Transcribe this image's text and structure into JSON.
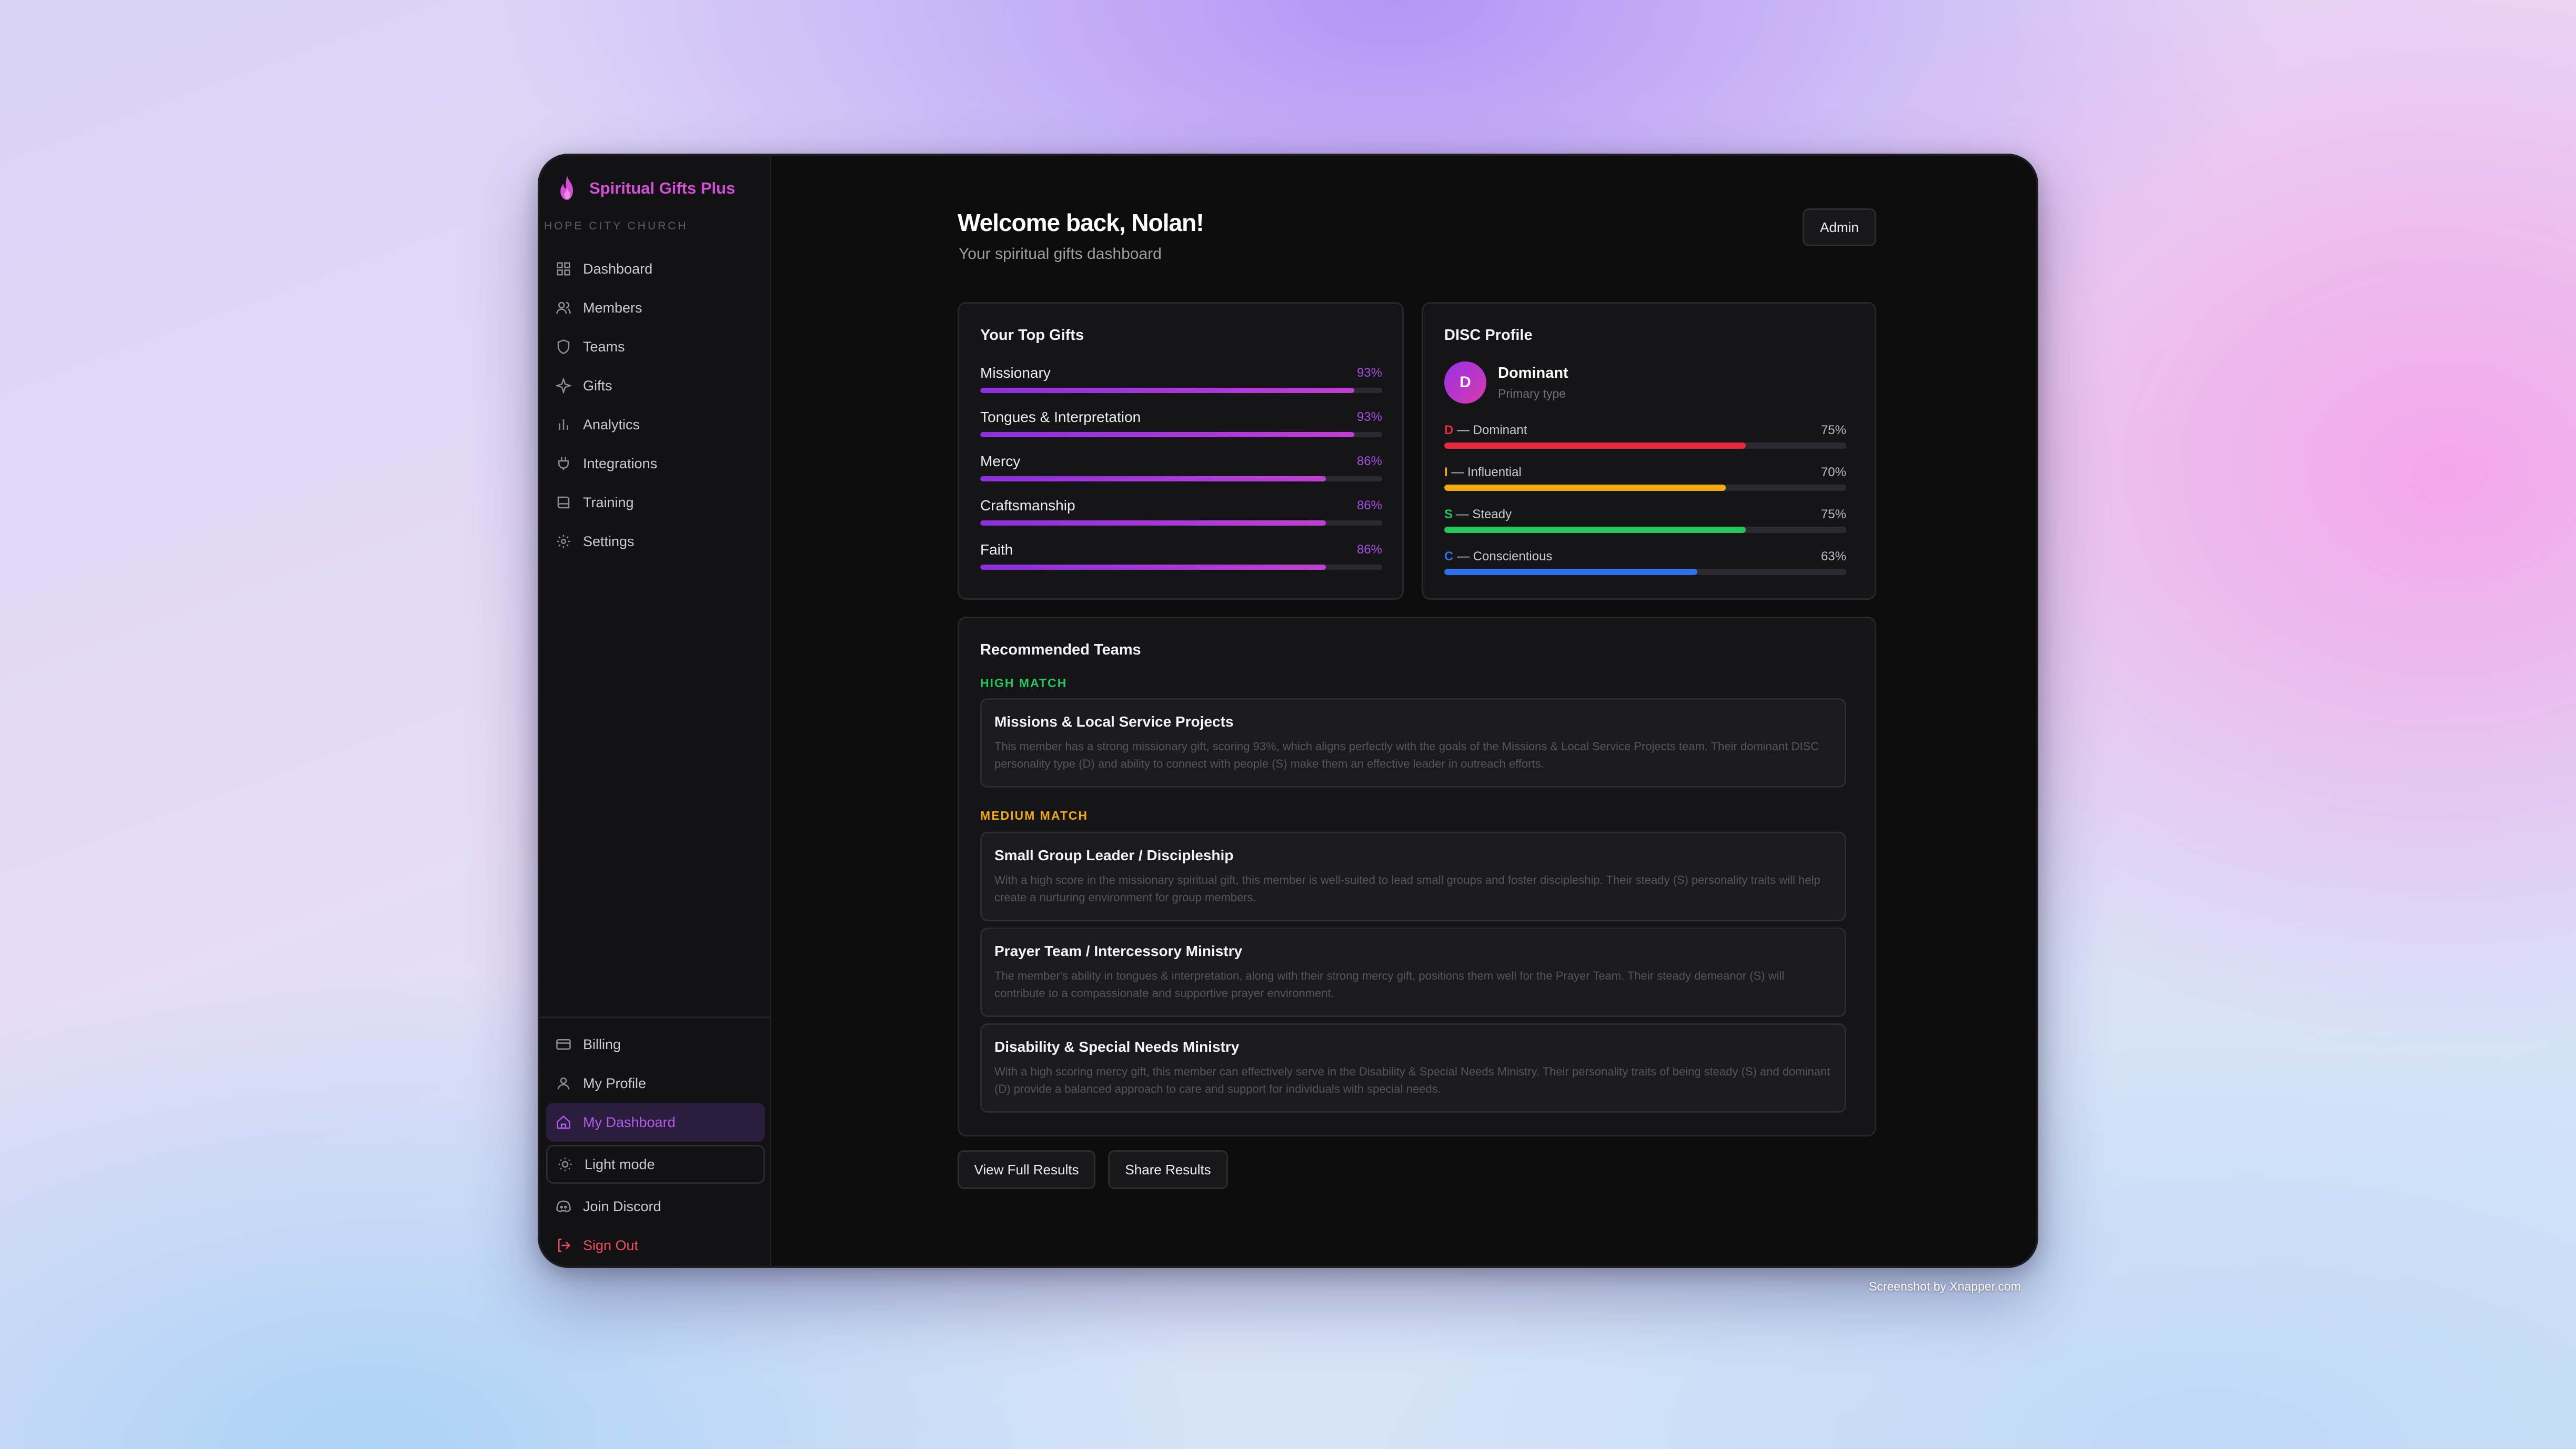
{
  "brand": {
    "name": "Spiritual Gifts Plus",
    "church": "HOPE CITY CHURCH",
    "accent": "#d24fd6"
  },
  "nav": [
    {
      "label": "Dashboard",
      "icon": "grid-icon"
    },
    {
      "label": "Members",
      "icon": "users-icon"
    },
    {
      "label": "Teams",
      "icon": "shield-icon"
    },
    {
      "label": "Gifts",
      "icon": "sparkle-icon"
    },
    {
      "label": "Analytics",
      "icon": "bar-chart-icon"
    },
    {
      "label": "Integrations",
      "icon": "plug-icon"
    },
    {
      "label": "Training",
      "icon": "book-icon"
    },
    {
      "label": "Settings",
      "icon": "gear-icon"
    }
  ],
  "bottom_nav": {
    "billing": "Billing",
    "profile": "My Profile",
    "my_dashboard": "My Dashboard",
    "light_mode": "Light mode",
    "discord": "Join Discord",
    "sign_out": "Sign Out"
  },
  "header": {
    "title": "Welcome back, Nolan!",
    "subtitle": "Your spiritual gifts dashboard",
    "admin_label": "Admin"
  },
  "top_gifts": {
    "title": "Your Top Gifts",
    "items": [
      {
        "name": "Missionary",
        "pct_label": "93%",
        "value": 0.93
      },
      {
        "name": "Tongues & Interpretation",
        "pct_label": "93%",
        "value": 0.93
      },
      {
        "name": "Mercy",
        "pct_label": "86%",
        "value": 0.86
      },
      {
        "name": "Craftsmanship",
        "pct_label": "86%",
        "value": 0.86
      },
      {
        "name": "Faith",
        "pct_label": "86%",
        "value": 0.86
      }
    ]
  },
  "disc": {
    "title": "DISC Profile",
    "avatar_letter": "D",
    "primary_name": "Dominant",
    "primary_caption": "Primary type",
    "rows": [
      {
        "letter": "D",
        "name": " — Dominant",
        "pct_label": "75%",
        "value": 0.75,
        "color": "#e8293d"
      },
      {
        "letter": "I",
        "name": " — Influential",
        "pct_label": "70%",
        "value": 0.7,
        "color": "#f2a90c"
      },
      {
        "letter": "S",
        "name": " — Steady",
        "pct_label": "75%",
        "value": 0.75,
        "color": "#22c55e"
      },
      {
        "letter": "C",
        "name": " — Conscientious",
        "pct_label": "63%",
        "value": 0.63,
        "color": "#2f6fe8"
      }
    ]
  },
  "teams": {
    "title": "Recommended Teams",
    "high_label": "HIGH MATCH",
    "high_color": "#22c55e",
    "medium_label": "MEDIUM MATCH",
    "medium_color": "#f2a90c",
    "items": [
      {
        "name": "Missions & Local Service Projects",
        "desc": "This member has a strong missionary gift, scoring 93%, which aligns perfectly with the goals of the Missions & Local Service Projects team. Their dominant DISC personality type (D) and ability to connect with people (S) make them an effective leader in outreach efforts."
      },
      {
        "name": "Small Group Leader / Discipleship",
        "desc": "With a high score in the missionary spiritual gift, this member is well-suited to lead small groups and foster discipleship. Their steady (S) personality traits will help create a nurturing environment for group members."
      },
      {
        "name": "Prayer Team / Intercessory Ministry",
        "desc": "The member's ability in tongues & interpretation, along with their strong mercy gift, positions them well for the Prayer Team. Their steady demeanor (S) will contribute to a compassionate and supportive prayer environment."
      },
      {
        "name": "Disability & Special Needs Ministry",
        "desc": "With a high scoring mercy gift, this member can effectively serve in the Disability & Special Needs Ministry. Their personality traits of being steady (S) and dominant (D) provide a balanced approach to care and support for individuals with special needs."
      }
    ]
  },
  "actions": {
    "view_full": "View Full Results",
    "share": "Share Results"
  },
  "credit": "Screenshot by Xnapper.com"
}
